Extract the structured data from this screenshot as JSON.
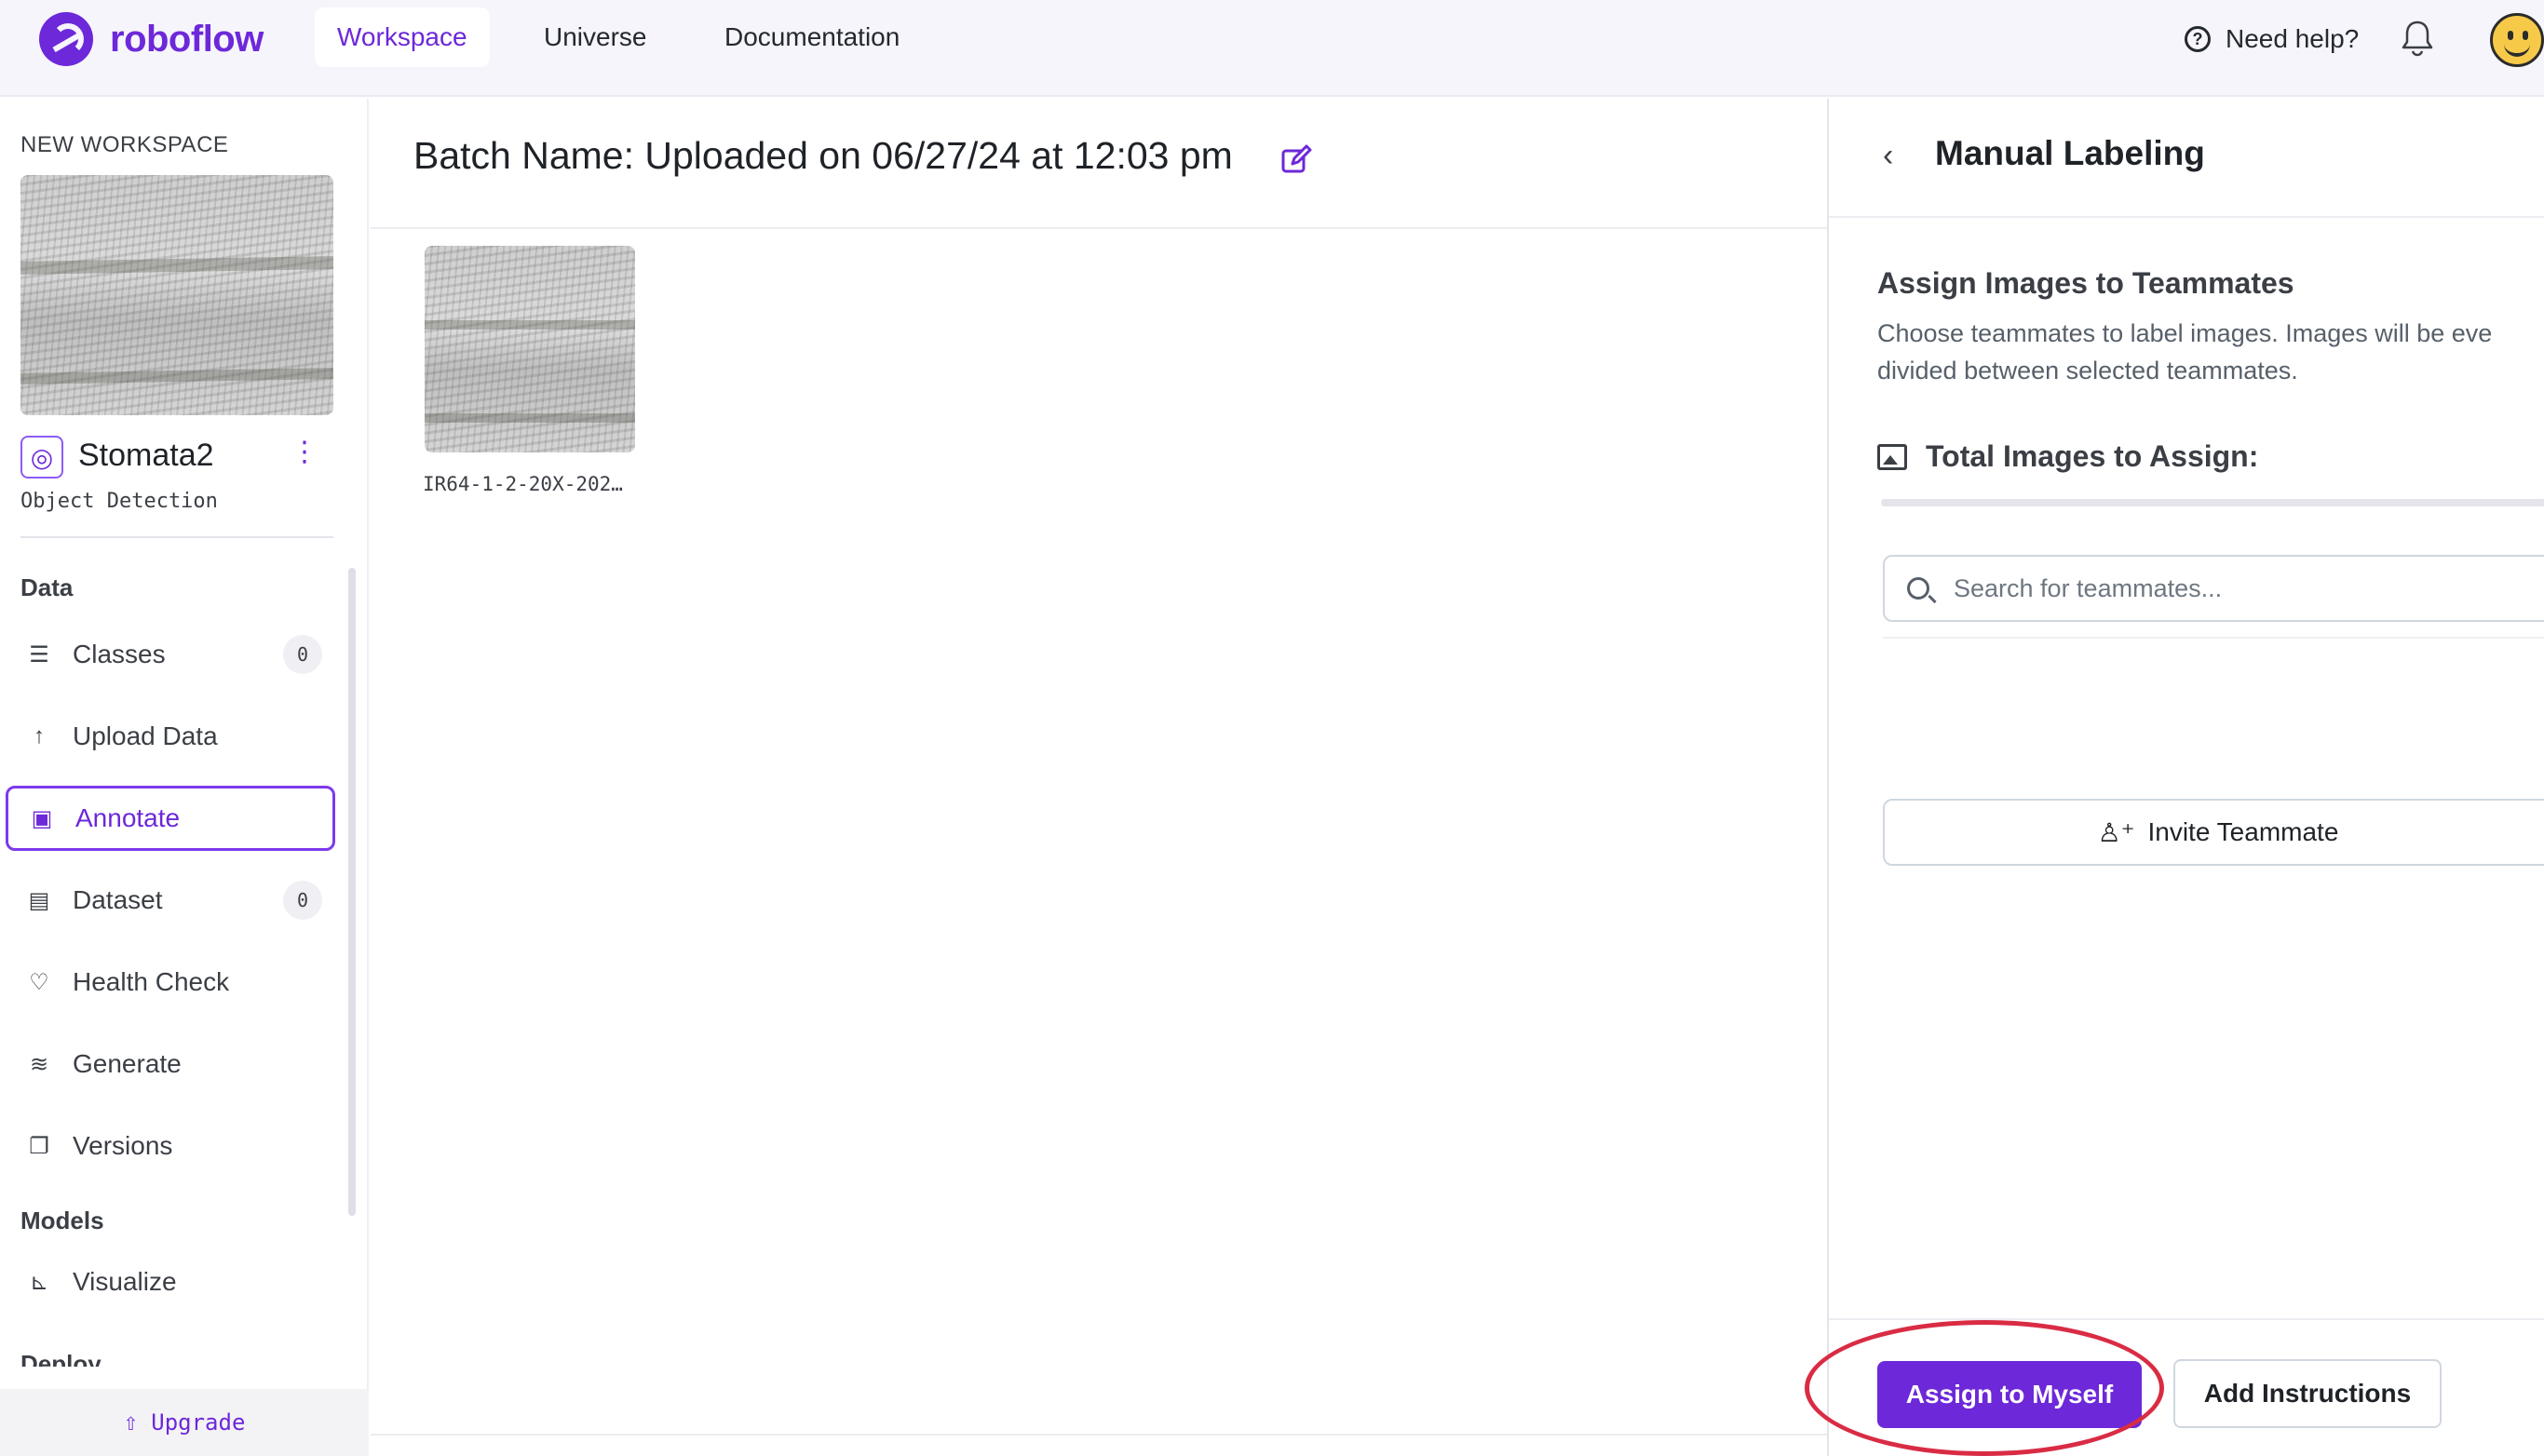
{
  "brand": {
    "name": "roboflow",
    "color": "#6d28d9"
  },
  "topnav": {
    "tabs": [
      {
        "label": "Workspace",
        "active": true
      },
      {
        "label": "Universe",
        "active": false
      },
      {
        "label": "Documentation",
        "active": false
      }
    ],
    "help_label": "Need help?"
  },
  "sidebar": {
    "workspace_label": "NEW WORKSPACE",
    "project_name": "Stomata2",
    "project_type": "Object Detection",
    "sections": {
      "data": "Data",
      "models": "Models",
      "deploy": "Deploy"
    },
    "items": [
      {
        "label": "Classes",
        "icon": "list-numbered-icon",
        "count": "0"
      },
      {
        "label": "Upload Data",
        "icon": "arrow-up-icon"
      },
      {
        "label": "Annotate",
        "icon": "annotate-icon",
        "active": true
      },
      {
        "label": "Dataset",
        "icon": "images-icon",
        "count": "0"
      },
      {
        "label": "Health Check",
        "icon": "heart-pulse-icon"
      },
      {
        "label": "Generate",
        "icon": "layers-icon"
      },
      {
        "label": "Versions",
        "icon": "versions-icon"
      },
      {
        "label": "Visualize",
        "icon": "bar-chart-icon"
      }
    ],
    "upgrade_label": "Upgrade"
  },
  "main": {
    "batch_title": "Batch Name: Uploaded on 06/27/24 at 12:03 pm",
    "images": [
      {
        "filename": "IR64-1-2-20X-202…"
      }
    ]
  },
  "panel": {
    "title": "Manual Labeling",
    "assign_title": "Assign Images to Teammates",
    "assign_desc_line1": "Choose teammates to label images. Images will be eve",
    "assign_desc_line2": "divided between selected teammates.",
    "total_label": "Total Images to Assign:",
    "search_placeholder": "Search for teammates...",
    "invite_label": "Invite Teammate",
    "assign_self_label": "Assign to Myself",
    "instructions_label": "Add Instructions"
  },
  "colors": {
    "accent": "#6d28d9",
    "highlight": "#d92c44"
  }
}
